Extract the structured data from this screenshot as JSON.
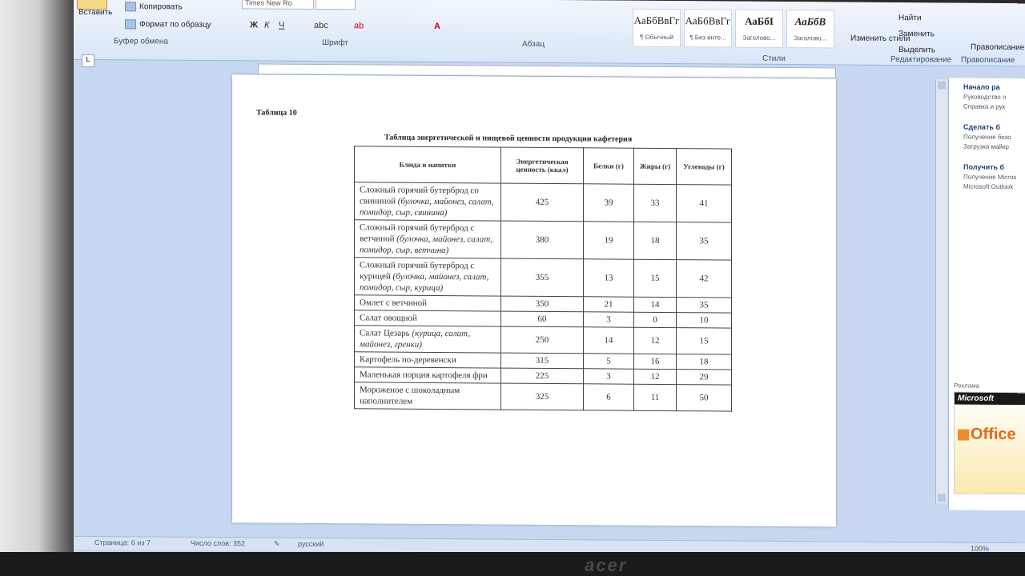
{
  "ribbon": {
    "paste_label": "Вставить",
    "copy_label": "Копировать",
    "format_painter_label": "Формат по образцу",
    "clipboard_group": "Буфер обмена",
    "font_name": "Times New Ro",
    "font_size": "",
    "font_group": "Шрифт",
    "paragraph_group": "Абзац",
    "styles_group": "Стили",
    "editing_group": "Редактирование",
    "proofing_group": "Правописание",
    "styles": [
      {
        "sample": "АаБбВвГг",
        "name": "¶ Обычный"
      },
      {
        "sample": "АаБбВвГг",
        "name": "¶ Без инте..."
      },
      {
        "sample": "АаБбІ",
        "name": "Заголово..."
      },
      {
        "sample": "АаБбВ",
        "name": "Заголово..."
      }
    ],
    "change_styles_label": "Изменить стили",
    "find_label": "Найти",
    "replace_label": "Заменить",
    "select_label": "Выделить",
    "spelling_label": "Правописание"
  },
  "document": {
    "table_number": "Таблица 10",
    "table_title": "Таблица энергетической и пищевой ценности продукции кафетерия",
    "headers": [
      "Блюда и напитки",
      "Энергетическая ценность (ккал)",
      "Белки (г)",
      "Жиры (г)",
      "Углеводы (г)"
    ],
    "rows": [
      {
        "dish": "Сложный горячий бутерброд со свининой",
        "note": "(булочка, майонез, салат, помидор, сыр, свинина)",
        "kcal": "425",
        "protein": "39",
        "fat": "33",
        "carbs": "41"
      },
      {
        "dish": "Сложный горячий бутерброд с ветчиной",
        "note": "(булочка, майонез, салат, помидор, сыр, ветчина)",
        "kcal": "380",
        "protein": "19",
        "fat": "18",
        "carbs": "35"
      },
      {
        "dish": "Сложный горячий бутерброд с курицей",
        "note": "(булочка, майонез, салат, помидор, сыр, курица)",
        "kcal": "355",
        "protein": "13",
        "fat": "15",
        "carbs": "42"
      },
      {
        "dish": "Омлет с ветчиной",
        "note": "",
        "kcal": "350",
        "protein": "21",
        "fat": "14",
        "carbs": "35"
      },
      {
        "dish": "Салат овощной",
        "note": "",
        "kcal": "60",
        "protein": "3",
        "fat": "0",
        "carbs": "10"
      },
      {
        "dish": "Салат Цезарь",
        "note": "(курица, салат, майонез, гренки)",
        "kcal": "250",
        "protein": "14",
        "fat": "12",
        "carbs": "15"
      },
      {
        "dish": "Картофель по-деревенски",
        "note": "",
        "kcal": "315",
        "protein": "5",
        "fat": "16",
        "carbs": "18"
      },
      {
        "dish": "Маленькая порция картофеля фри",
        "note": "",
        "kcal": "225",
        "protein": "3",
        "fat": "12",
        "carbs": "29"
      },
      {
        "dish": "Мороженое с шоколадным наполнителем",
        "note": "",
        "kcal": "325",
        "protein": "6",
        "fat": "11",
        "carbs": "50"
      }
    ]
  },
  "side_pane": {
    "item1_title": "Начало ра",
    "item1_lines": [
      "Руководство п",
      "Справка и рук"
    ],
    "item2_title": "Сделать б",
    "item2_lines": [
      "Получение безо",
      "Загрузка майкр"
    ],
    "item3_title": "Получить б",
    "item3_lines": [
      "Получение Micros",
      "Microsoft Outlook"
    ],
    "ad_label": "Реклама",
    "ad_brand": "Microsoft",
    "ad_product": "Office"
  },
  "status": {
    "page": "Страница: 6 из 7",
    "words": "Число слов: 352",
    "language": "русский",
    "zoom": "100%"
  },
  "brand": "acer"
}
